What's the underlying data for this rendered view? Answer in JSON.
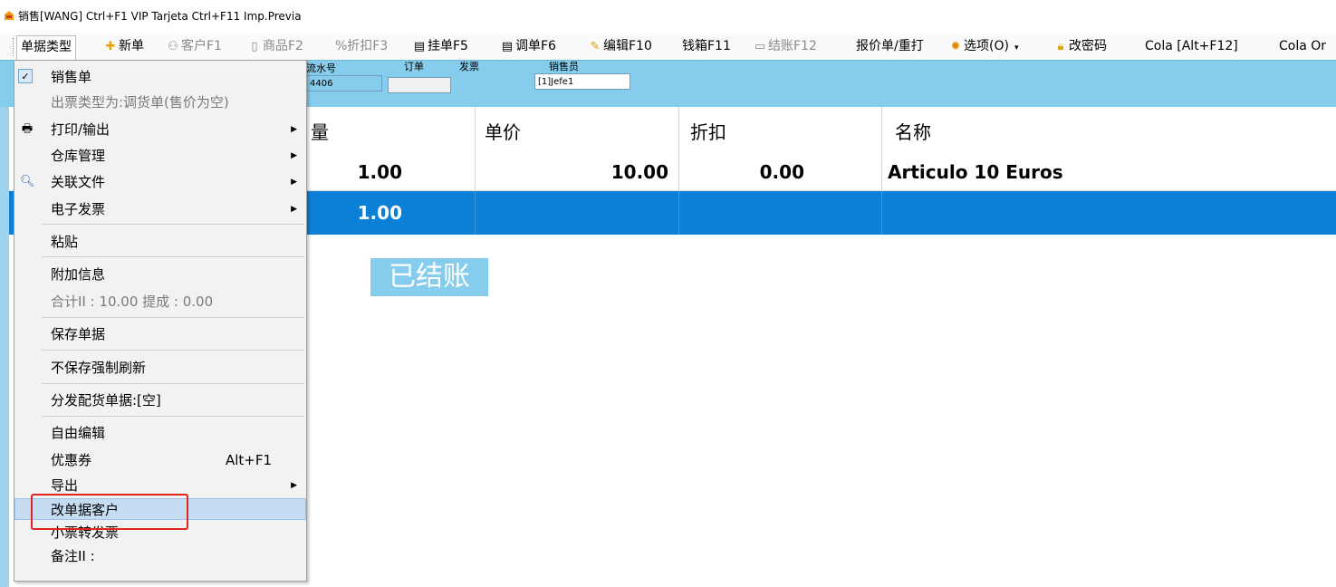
{
  "titlebar": {
    "title": "销售[WANG]    Ctrl+F1 VIP Tarjeta   Ctrl+F11 Imp.Previa"
  },
  "toolbar": {
    "items": [
      {
        "label": "单据类型"
      },
      {
        "label": "新单"
      },
      {
        "label": "客户F1"
      },
      {
        "label": "商品F2"
      },
      {
        "label": "%折扣F3"
      },
      {
        "label": "挂单F5"
      },
      {
        "label": "调单F6"
      },
      {
        "label": "编辑F10"
      },
      {
        "label": "钱箱F11"
      },
      {
        "label": "结账F12"
      },
      {
        "label": "报价单/重打"
      },
      {
        "label": "选项(O)"
      },
      {
        "label": "改密码"
      },
      {
        "label": "Cola [Alt+F12]"
      },
      {
        "label": "Cola Or"
      }
    ]
  },
  "info": {
    "serial_label": "流水号",
    "serial_value": "4406",
    "order_label": "订单",
    "invoice_label": "发票",
    "seller_label": "销售员",
    "seller_value": "[1]Jefe1"
  },
  "grid": {
    "headers": [
      "量",
      "单价",
      "折扣",
      "名称"
    ],
    "rows": [
      [
        "1.00",
        "10.00",
        "0.00",
        "Articulo 10 Euros"
      ],
      [
        "1.00",
        "",
        "",
        ""
      ]
    ],
    "status_stamp": "已结账"
  },
  "menu": {
    "items": [
      {
        "label": "销售单"
      },
      {
        "label": "出票类型为:调货单(售价为空)"
      },
      {
        "label": "打印/输出"
      },
      {
        "label": "仓库管理"
      },
      {
        "label": "关联文件"
      },
      {
        "label": "电子发票"
      },
      {
        "label": "粘贴"
      },
      {
        "label": "附加信息"
      },
      {
        "label": "合计II : 10.00  提成 : 0.00"
      },
      {
        "label": "保存单据"
      },
      {
        "label": "不保存强制刷新"
      },
      {
        "label": "分发配货单据:[空]"
      },
      {
        "label": "自由编辑"
      },
      {
        "label": "优惠券",
        "shortcut": "Alt+F1"
      },
      {
        "label": "导出"
      },
      {
        "label": "改单据客户"
      },
      {
        "label": "小票转发票"
      },
      {
        "label": "备注II :"
      }
    ]
  },
  "colors": {
    "accent_blue": "#86ccec",
    "selected_row": "#0c7fd7",
    "highlight_box": "#e0261f"
  }
}
